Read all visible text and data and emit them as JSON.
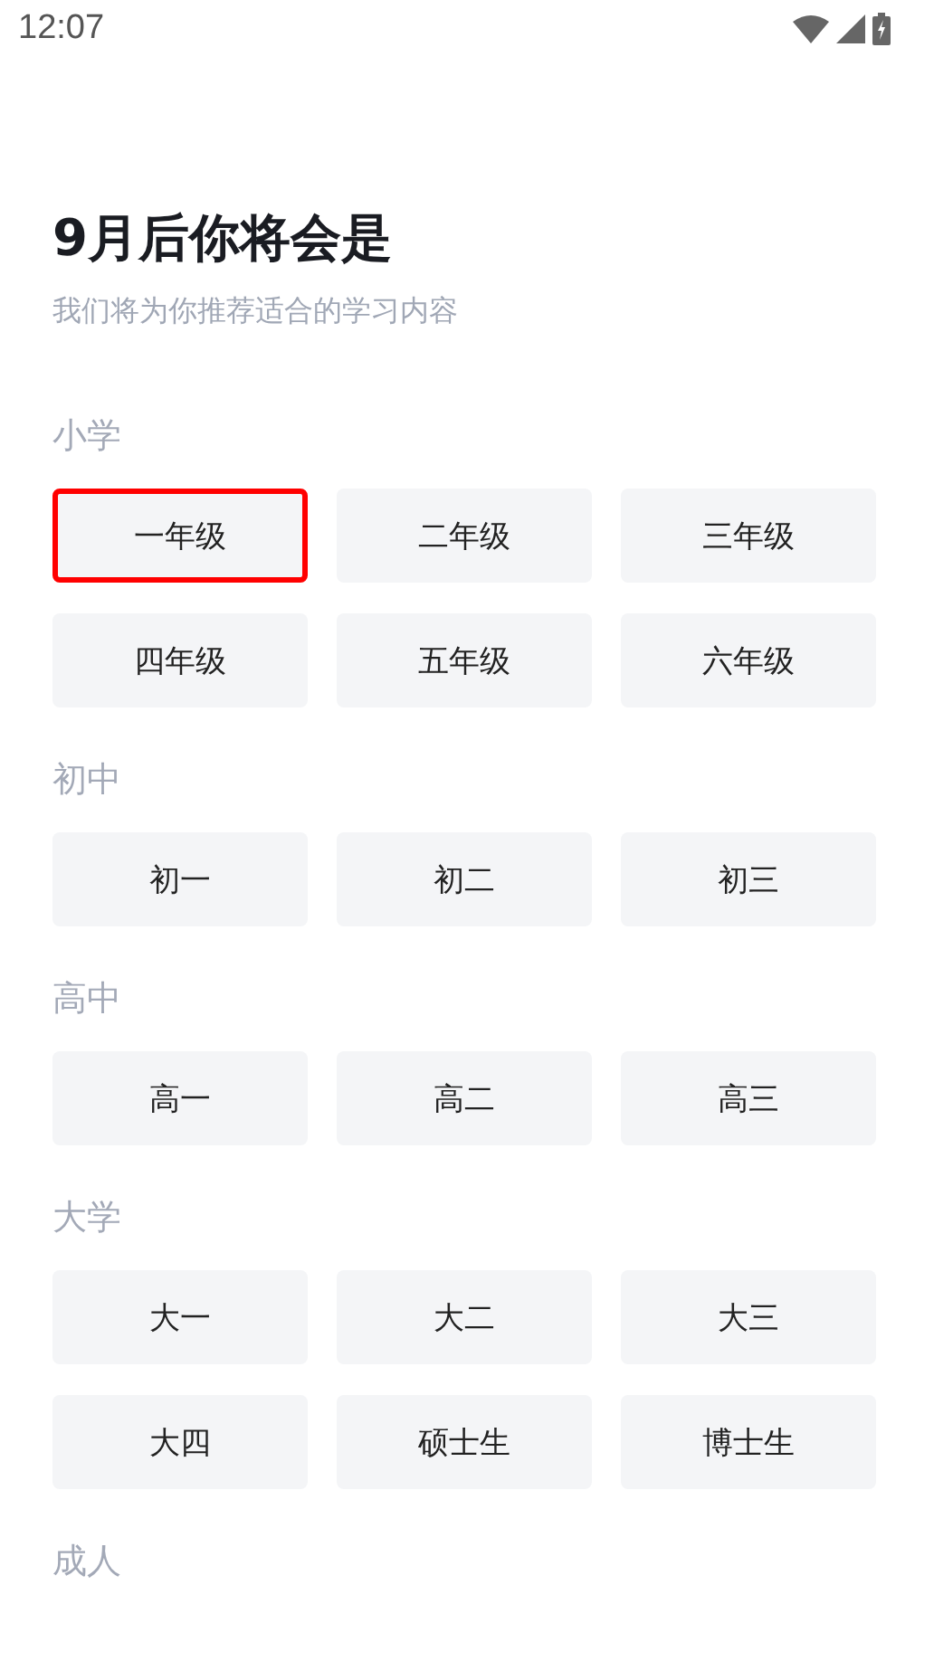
{
  "status_bar": {
    "time": "12:07"
  },
  "title": "9月后你将会是",
  "subtitle": "我们将为你推荐适合的学习内容",
  "sections": [
    {
      "label": "小学",
      "options": [
        {
          "label": "一年级",
          "selected": true
        },
        {
          "label": "二年级",
          "selected": false
        },
        {
          "label": "三年级",
          "selected": false
        },
        {
          "label": "四年级",
          "selected": false
        },
        {
          "label": "五年级",
          "selected": false
        },
        {
          "label": "六年级",
          "selected": false
        }
      ]
    },
    {
      "label": "初中",
      "options": [
        {
          "label": "初一",
          "selected": false
        },
        {
          "label": "初二",
          "selected": false
        },
        {
          "label": "初三",
          "selected": false
        }
      ]
    },
    {
      "label": "高中",
      "options": [
        {
          "label": "高一",
          "selected": false
        },
        {
          "label": "高二",
          "selected": false
        },
        {
          "label": "高三",
          "selected": false
        }
      ]
    },
    {
      "label": "大学",
      "options": [
        {
          "label": "大一",
          "selected": false
        },
        {
          "label": "大二",
          "selected": false
        },
        {
          "label": "大三",
          "selected": false
        },
        {
          "label": "大四",
          "selected": false
        },
        {
          "label": "硕士生",
          "selected": false
        },
        {
          "label": "博士生",
          "selected": false
        }
      ]
    },
    {
      "label": "成人"
    }
  ]
}
